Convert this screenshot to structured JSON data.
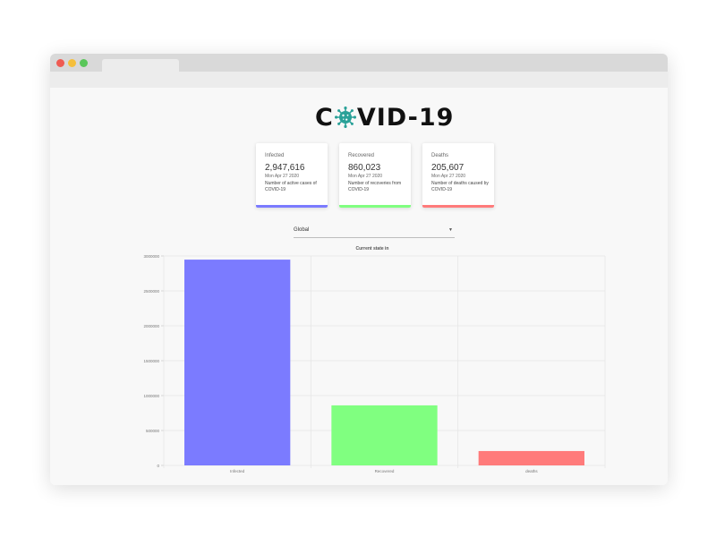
{
  "logo": {
    "text_left": "C",
    "text_right": "VID-19"
  },
  "cards": [
    {
      "label": "Infected",
      "value": "2,947,616",
      "date": "Mon Apr 27 2020",
      "description": "Number of active cases of COVID-19",
      "color": "#7b7bff"
    },
    {
      "label": "Recovered",
      "value": "860,023",
      "date": "Mon Apr 27 2020",
      "description": "Number of recoveries from COVID-19",
      "color": "#80ff80"
    },
    {
      "label": "Deaths",
      "value": "205,607",
      "date": "Mon Apr 27 2020",
      "description": "Number of deaths caused by COVID-19",
      "color": "#ff7b7b"
    }
  ],
  "country_select": {
    "selected": "Global"
  },
  "chart_data": {
    "type": "bar",
    "title": "Current state in",
    "categories": [
      "Infected",
      "Recovered",
      "deaths"
    ],
    "values": [
      2947616,
      860023,
      205607
    ],
    "colors": [
      "#7b7bff",
      "#80ff80",
      "#ff7b7b"
    ],
    "yticks": [
      0,
      500000,
      1000000,
      1500000,
      2000000,
      2500000,
      3000000
    ],
    "ylim": [
      0,
      3000000
    ],
    "grid": true,
    "legend": "none"
  }
}
